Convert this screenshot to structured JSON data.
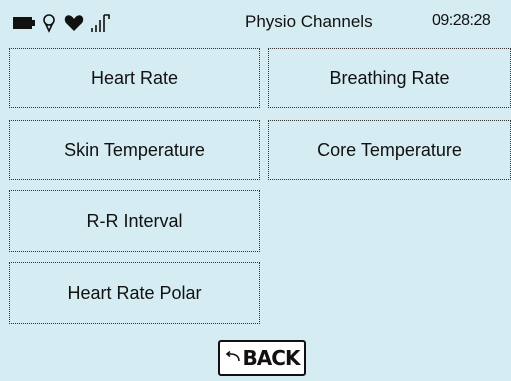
{
  "status": {
    "title": "Physio Channels",
    "time": "09:28:28",
    "icons": [
      "battery-icon",
      "location-pin-icon",
      "heart-icon",
      "signal-icon"
    ]
  },
  "tiles": [
    {
      "label": "Heart Rate"
    },
    {
      "label": "Breathing Rate"
    },
    {
      "label": "Skin Temperature"
    },
    {
      "label": "Core Temperature"
    },
    {
      "label": "R-R Interval"
    },
    {
      "label": "Heart Rate Polar"
    }
  ],
  "back": {
    "label": "BACK",
    "icon": "back-arrow-icon"
  }
}
